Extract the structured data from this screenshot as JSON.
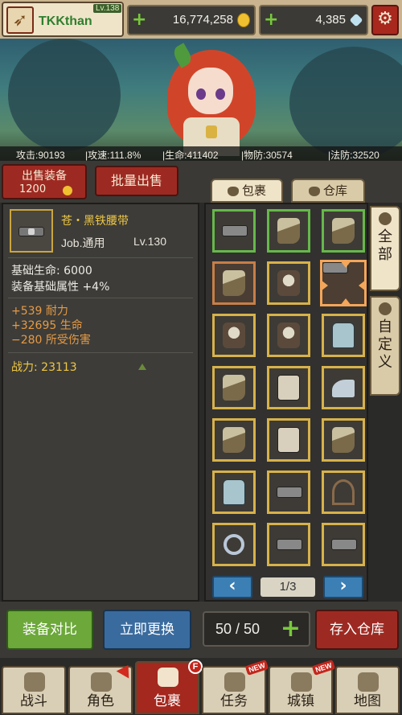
{
  "topbar": {
    "player_name": "TKKthan",
    "level": "Lv.138",
    "gold": "16,774,258",
    "gems": "4,385",
    "gold_icon": "gold-coin-icon",
    "gem_icon": "diamond-icon",
    "settings_icon": "gear-icon"
  },
  "stats": {
    "attack": "攻击:90193",
    "attack_speed": "|攻速:111.8%",
    "hp": "|生命:411402",
    "physical_def": "|物防:30574",
    "magic_def": "|法防:32520"
  },
  "sell": {
    "sell_label": "出售装备",
    "sell_price": "1200",
    "bulk_label": "批量出售"
  },
  "tabs": [
    {
      "label": "包裹",
      "icon": "bag-icon"
    },
    {
      "label": "仓库",
      "icon": "warehouse-icon"
    }
  ],
  "item": {
    "name": "苍・黑铁腰带",
    "job": "Job.通用",
    "level": "Lv.130",
    "base_hp": "基础生命: 6000",
    "base_bonus": "装备基础属性 +4%",
    "attr1": "+539 耐力",
    "attr2": "+32695 生命",
    "attr3": "−280 所受伤害",
    "power": "战力: 23113"
  },
  "grid": {
    "cells": [
      {
        "type": "belt",
        "quality": "green"
      },
      {
        "type": "gauntlet",
        "quality": "green"
      },
      {
        "type": "boot",
        "quality": "green"
      },
      {
        "type": "boot",
        "quality": "orange"
      },
      {
        "type": "armor",
        "quality": "gold"
      },
      {
        "type": "belt",
        "quality": "selected"
      },
      {
        "type": "armor",
        "quality": "gold"
      },
      {
        "type": "armor",
        "quality": "gold"
      },
      {
        "type": "shirt",
        "quality": "gold"
      },
      {
        "type": "boot",
        "quality": "gold"
      },
      {
        "type": "pants",
        "quality": "gold"
      },
      {
        "type": "hat",
        "quality": "gold"
      },
      {
        "type": "gauntlet",
        "quality": "gold"
      },
      {
        "type": "pants",
        "quality": "gold"
      },
      {
        "type": "boot",
        "quality": "gold"
      },
      {
        "type": "shirt",
        "quality": "gold"
      },
      {
        "type": "belt",
        "quality": "gold"
      },
      {
        "type": "bow",
        "quality": "gold"
      },
      {
        "type": "ring",
        "quality": "gold"
      },
      {
        "type": "belt",
        "quality": "gold"
      },
      {
        "type": "belt",
        "quality": "gold"
      }
    ],
    "page_label": "1/3"
  },
  "side_tabs": [
    {
      "label": "全部",
      "icon": "bag-icon"
    },
    {
      "label": "自定义",
      "icon": "gear-icon"
    }
  ],
  "actions": {
    "compare": "装备对比",
    "replace": "立即更换",
    "capacity": "50 / 50",
    "store": "存入仓库"
  },
  "nav": [
    {
      "label": "战斗",
      "icon": "swords-icon",
      "badge": ""
    },
    {
      "label": "角色",
      "icon": "character-icon",
      "badge": "arrow"
    },
    {
      "label": "包裹",
      "icon": "bag-icon",
      "badge": "F"
    },
    {
      "label": "任务",
      "icon": "scroll-icon",
      "badge": "NEW"
    },
    {
      "label": "城镇",
      "icon": "castle-icon",
      "badge": "NEW"
    },
    {
      "label": "地图",
      "icon": "map-icon",
      "badge": ""
    }
  ]
}
